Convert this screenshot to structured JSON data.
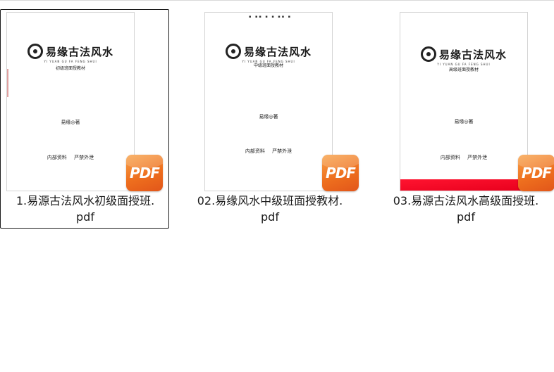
{
  "files": [
    {
      "name": "1.易源古法风水初级面授班.pdf",
      "name_line1": "1.易源古法风水初级面授班.",
      "name_line2": "pdf",
      "selected": true,
      "cover": {
        "logo": "易缘古法风水",
        "logo_sub": "YI YUAN GU FA FENG SHUI",
        "subtitle": "初级班面授教材",
        "author": "易缘◎著",
        "internal": "内部资料 严禁外泄"
      },
      "badge_label": "PDF",
      "badge_icon": "pdf-file-icon"
    },
    {
      "name": "02.易缘风水中级班面授教材.pdf",
      "name_line1": "02.易缘风水中级班面授教材.",
      "name_line2": "pdf",
      "selected": false,
      "cover": {
        "logo": "易缘古法风水",
        "logo_sub": "YI YUAN GU FA FENG SHUI",
        "subtitle": "中级班面授教材",
        "author": "易缘◎著",
        "internal": "内部资料 严禁外泄"
      },
      "badge_label": "PDF",
      "badge_icon": "pdf-file-icon"
    },
    {
      "name": "03.易源古法风水高级面授班.pdf",
      "name_line1": "03.易源古法风水高级面授班.",
      "name_line2": "pdf",
      "selected": false,
      "cover": {
        "logo": "易缘古法风水",
        "logo_sub": "YI YUAN GU FA FENG SHUI",
        "subtitle": "高级班面授教材",
        "author": "易缘◎著",
        "internal": "内部资料 严禁外泄"
      },
      "badge_label": "PDF",
      "badge_icon": "pdf-file-icon"
    }
  ],
  "colors": {
    "selection_border": "#1a1a1a",
    "pdf_badge": "#ee6f1e",
    "red_strip": "#ff1430"
  }
}
